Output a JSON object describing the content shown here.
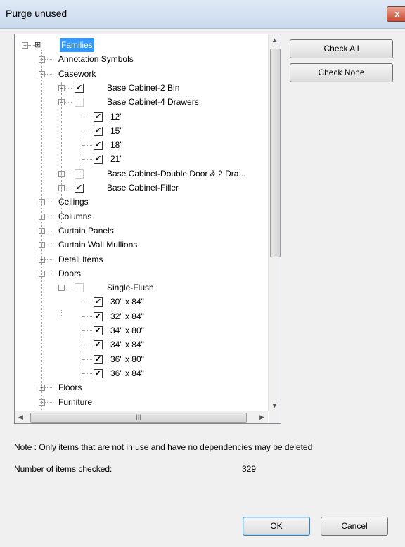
{
  "window": {
    "title": "Purge unused",
    "close_label": "x"
  },
  "buttons": {
    "check_all": "Check All",
    "check_none": "Check None",
    "ok": "OK",
    "cancel": "Cancel"
  },
  "note": "Note : Only items that are not in use and have no dependencies may be deleted",
  "count_label": "Number of items checked:",
  "count_value": "329",
  "tree": [
    {
      "label": "Families",
      "level": 0,
      "expander": "minus",
      "selected": true,
      "icon": "families-icon"
    },
    {
      "label": "Annotation Symbols",
      "level": 1,
      "expander": "plus"
    },
    {
      "label": "Casework",
      "level": 1,
      "expander": "minus"
    },
    {
      "label": "Base Cabinet-2 Bin",
      "level": 2,
      "expander": "plus",
      "checkbox": "checked"
    },
    {
      "label": "Base Cabinet-4 Drawers",
      "level": 2,
      "expander": "minus",
      "checkbox": "unchecked"
    },
    {
      "label": "12\"",
      "level": 3,
      "checkbox": "checked"
    },
    {
      "label": "15\"",
      "level": 3,
      "checkbox": "checked"
    },
    {
      "label": "18\"",
      "level": 3,
      "checkbox": "checked"
    },
    {
      "label": "21\"",
      "level": 3,
      "checkbox": "checked"
    },
    {
      "label": "Base Cabinet-Double Door & 2 Dra...",
      "level": 2,
      "expander": "plus",
      "checkbox": "unchecked"
    },
    {
      "label": "Base Cabinet-Filler",
      "level": 2,
      "expander": "plus",
      "checkbox": "checked"
    },
    {
      "label": "Ceilings",
      "level": 1,
      "expander": "plus"
    },
    {
      "label": "Columns",
      "level": 1,
      "expander": "plus"
    },
    {
      "label": "Curtain Panels",
      "level": 1,
      "expander": "plus"
    },
    {
      "label": "Curtain Wall Mullions",
      "level": 1,
      "expander": "plus"
    },
    {
      "label": "Detail Items",
      "level": 1,
      "expander": "plus"
    },
    {
      "label": "Doors",
      "level": 1,
      "expander": "minus"
    },
    {
      "label": "Single-Flush",
      "level": 2,
      "expander": "minus",
      "checkbox": "unchecked"
    },
    {
      "label": "30\" x 84\"",
      "level": 3,
      "checkbox": "checked"
    },
    {
      "label": "32\" x 84\"",
      "level": 3,
      "checkbox": "checked"
    },
    {
      "label": "34\" x 80\"",
      "level": 3,
      "checkbox": "checked"
    },
    {
      "label": "34\" x 84\"",
      "level": 3,
      "checkbox": "checked"
    },
    {
      "label": "36\" x 80\"",
      "level": 3,
      "checkbox": "checked"
    },
    {
      "label": "36\" x 84\"",
      "level": 3,
      "checkbox": "checked"
    },
    {
      "label": "Floors",
      "level": 1,
      "expander": "plus"
    },
    {
      "label": "Furniture",
      "level": 1,
      "expander": "plus"
    }
  ]
}
